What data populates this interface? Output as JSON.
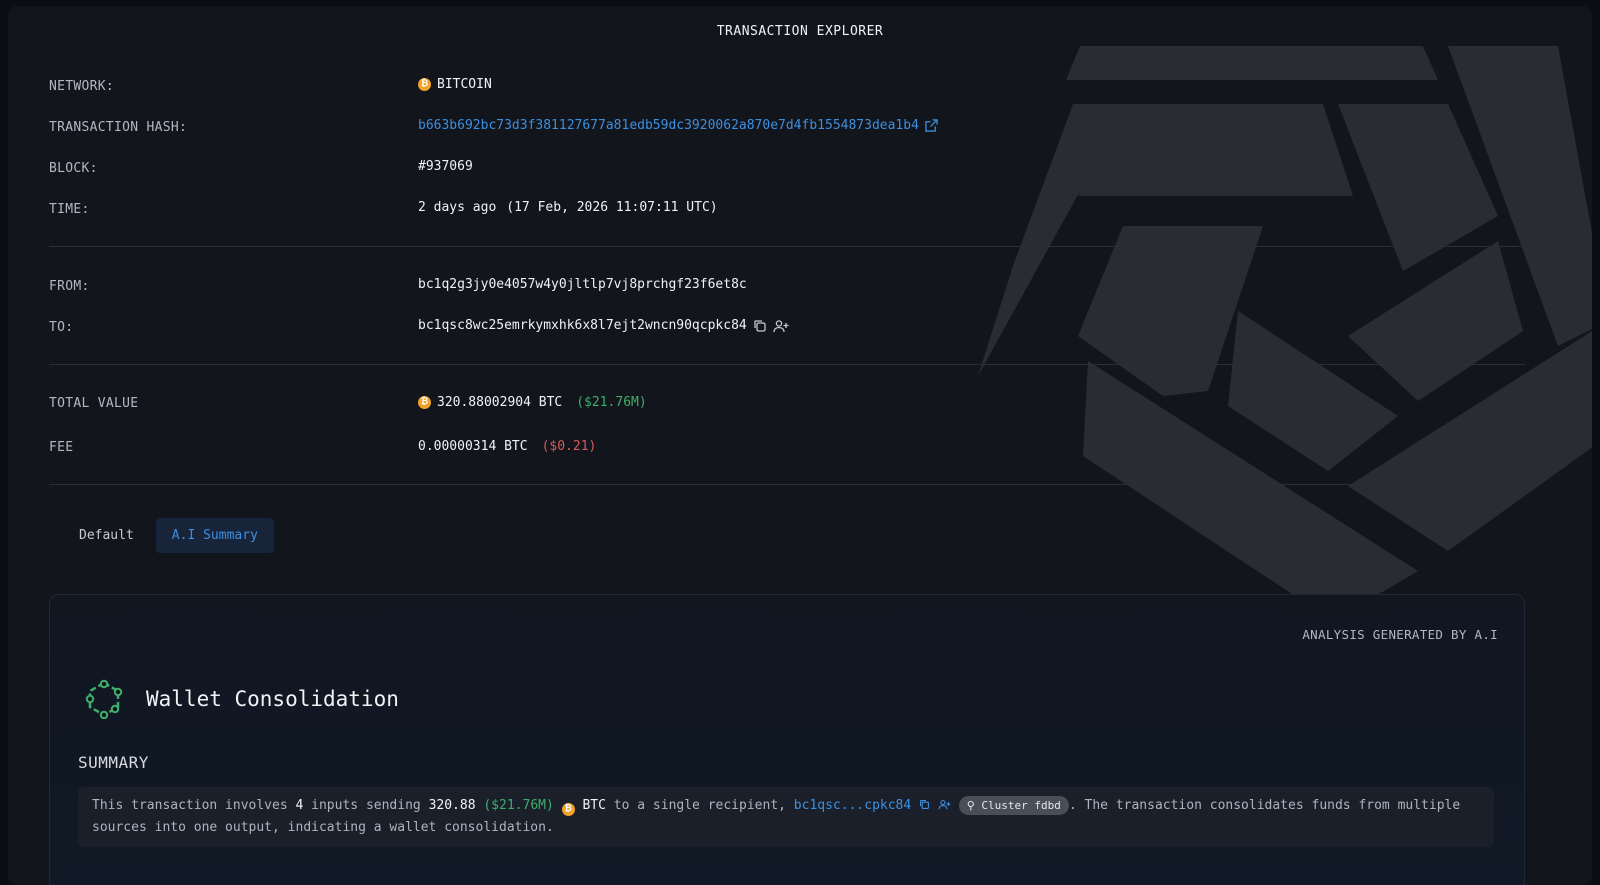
{
  "title": "TRANSACTION EXPLORER",
  "details": {
    "network": {
      "label": "NETWORK:",
      "value": "BITCOIN"
    },
    "hash": {
      "label": "TRANSACTION HASH:",
      "value": "b663b692bc73d3f381127677a81edb59dc3920062a870e7d4fb1554873dea1b4"
    },
    "block": {
      "label": "BLOCK:",
      "value": "#937069"
    },
    "time": {
      "label": "TIME:",
      "relative": "2 days ago",
      "absolute": "(17 Feb, 2026 11:07:11 UTC)"
    },
    "from": {
      "label": "FROM:",
      "value": "bc1q2g3jy0e4057w4y0jltlp7vj8prchgf23f6et8c"
    },
    "to": {
      "label": "TO:",
      "value": "bc1qsc8wc25emrkymxhk6x8l7ejt2wncn90qcpkc84"
    },
    "total_value": {
      "label": "TOTAL VALUE",
      "amount": "320.88002904 BTC",
      "usd": "($21.76M)"
    },
    "fee": {
      "label": "FEE",
      "amount": "0.00000314 BTC",
      "usd": "($0.21)"
    }
  },
  "tabs": [
    {
      "label": "Default"
    },
    {
      "label": "A.I Summary",
      "active": true
    }
  ],
  "analysis": {
    "generated_label": "ANALYSIS GENERATED BY A.I",
    "heading": "Wallet Consolidation",
    "summary_title": "SUMMARY",
    "summary": {
      "p1": "This transaction involves ",
      "inputs": "4",
      "p2": " inputs sending ",
      "amount": "320.88",
      "usd": "($21.76M)",
      "currency": "BTC",
      "p3": " to a single recipient, ",
      "recipient": "bc1qsc...cpkc84",
      "cluster": "Cluster fdbd",
      "p4": ". The transaction consolidates funds from multiple sources into one output, indicating a wallet consolidation."
    }
  },
  "icons": {
    "bitcoin": "bitcoin-icon",
    "external": "external-link-icon",
    "copy": "copy-icon",
    "add_user": "add-user-icon",
    "consolidation": "consolidation-icon",
    "cluster": "cluster-icon"
  },
  "colors": {
    "link": "#3c8fe0",
    "positive": "#3fae6b",
    "negative": "#d05b5b",
    "bitcoin": "#f2a227"
  }
}
